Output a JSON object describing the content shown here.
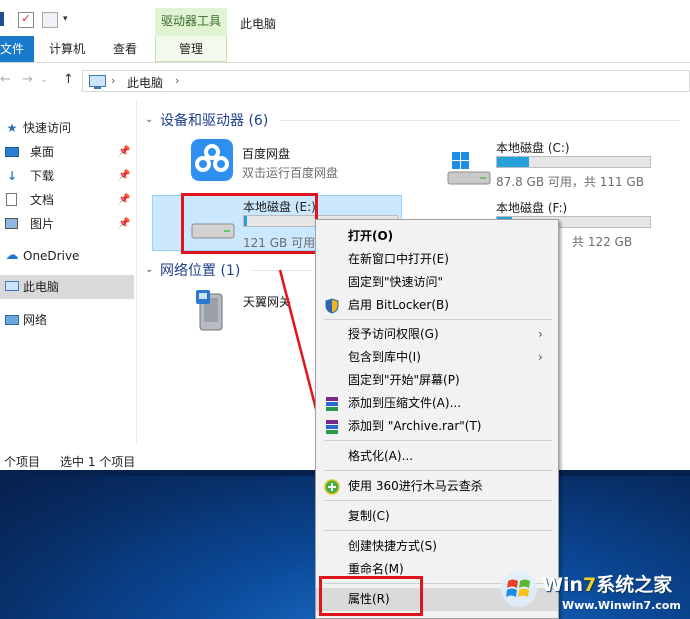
{
  "window": {
    "context_tab": "驱动器工具",
    "title": "此电脑"
  },
  "ribbon": {
    "tabs": [
      "文件",
      "计算机",
      "查看",
      "管理"
    ]
  },
  "address": {
    "path": [
      "此电脑"
    ]
  },
  "nav": {
    "items": [
      {
        "label": "快速访问",
        "icon": "star-icon"
      },
      {
        "label": "桌面",
        "icon": "desktop-icon",
        "pinned": true
      },
      {
        "label": "下载",
        "icon": "download-icon",
        "pinned": true
      },
      {
        "label": "文档",
        "icon": "documents-icon",
        "pinned": true
      },
      {
        "label": "图片",
        "icon": "pictures-icon",
        "pinned": true
      },
      {
        "label": "OneDrive",
        "icon": "cloud-icon"
      },
      {
        "label": "此电脑",
        "icon": "computer-icon",
        "selected": true
      },
      {
        "label": "网络",
        "icon": "network-icon"
      }
    ]
  },
  "groups": {
    "devices": "设备和驱动器 (6)",
    "network": "网络位置 (1)"
  },
  "tiles": {
    "baidu": {
      "name": "百度网盘",
      "sub": "双击运行百度网盘"
    },
    "c_drive": {
      "name": "本地磁盘 (C:)",
      "sub": "87.8 GB 可用，共 111 GB",
      "used_fraction": 0.21
    },
    "e_drive": {
      "name": "本地磁盘 (E:)",
      "sub": "121 GB 可用",
      "used_fraction": 0.02
    },
    "f_drive": {
      "name": "本地磁盘 (F:)",
      "sub": "共 122 GB",
      "used_fraction": 0.1
    },
    "tianyi": {
      "name": "天翼网关"
    }
  },
  "status": {
    "count": "个项目",
    "selected": "选中 1 个项目"
  },
  "context_menu": {
    "items": {
      "open": "打开(O)",
      "open_new_window": "在新窗口中打开(E)",
      "pin_quick": "固定到\"快速访问\"",
      "bitlocker": "启用 BitLocker(B)",
      "grant_access": "授予访问权限(G)",
      "include_library": "包含到库中(I)",
      "pin_start": "固定到\"开始\"屏幕(P)",
      "add_archive": "添加到压缩文件(A)...",
      "add_rar": "添加到 \"Archive.rar\"(T)",
      "format": "格式化(A)...",
      "scan360": "使用 360进行木马云查杀",
      "copy": "复制(C)",
      "shortcut": "创建快捷方式(S)",
      "rename": "重命名(M)",
      "properties": "属性(R)"
    }
  },
  "watermark": {
    "title_a": "Win",
    "title_b": "7",
    "title_c": "系统之家",
    "url": "Www.Winwin7.com"
  }
}
